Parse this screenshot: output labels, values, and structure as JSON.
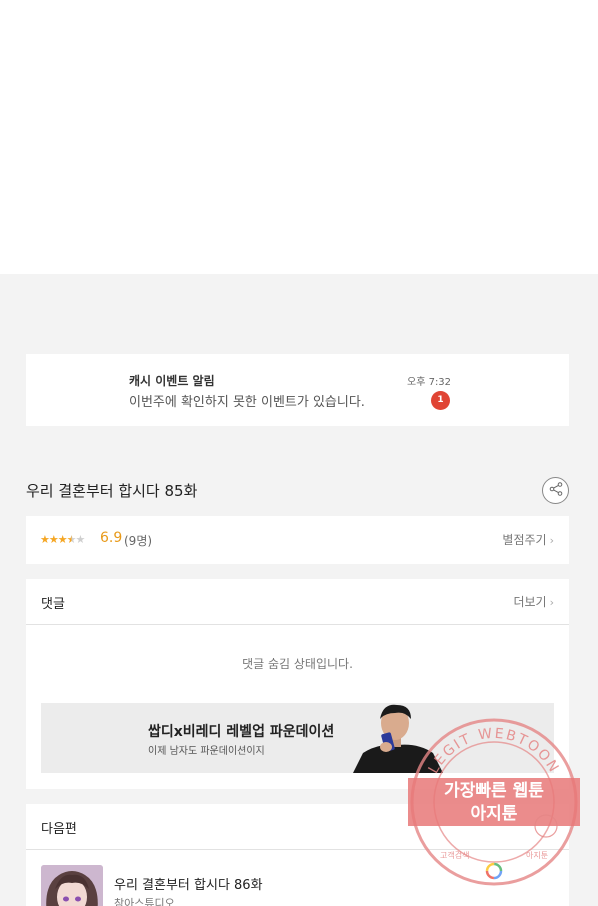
{
  "notification": {
    "title": "캐시 이벤트 알림",
    "message": "이번주에 확인하지 못한 이벤트가 있습니다.",
    "time": "오후 7:32",
    "badge_count": "1"
  },
  "episode": {
    "title": "우리 결혼부터 합시다 85화",
    "share_icon": "share-icon"
  },
  "rating": {
    "stars_value": 3.5,
    "stars_max": 5,
    "score": "6.9",
    "count": "(9명)",
    "rate_link": "별점주기"
  },
  "comments": {
    "title": "댓글",
    "more_label": "더보기",
    "hidden_message": "댓글 숨김 상태입니다."
  },
  "ad": {
    "title": "쌉디x비레디 레벨업 파운데이션",
    "subtitle": "이제 남자도 파운데이션이지"
  },
  "next_episode": {
    "section_title": "다음편",
    "episode_title": "우리 결혼부터 합시다 86화",
    "studio": "참아스튜디오"
  },
  "watermark": {
    "ring_text": "LEGIT WEBTOON",
    "line1": "가장빠른 웹툰",
    "line2": "아지툰",
    "bottom_left": "고객검색",
    "bottom_right": "아지툰",
    "colors": {
      "ring": "#e58686",
      "banner": "#e87878"
    }
  }
}
